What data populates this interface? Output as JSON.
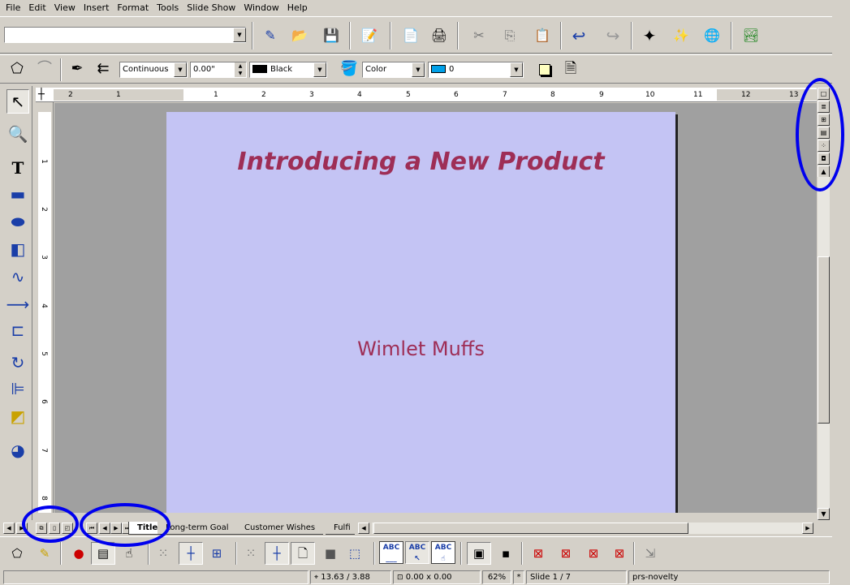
{
  "menu": [
    "File",
    "Edit",
    "View",
    "Insert",
    "Format",
    "Tools",
    "Slide Show",
    "Window",
    "Help"
  ],
  "function_bar": {
    "url_input_value": ""
  },
  "object_bar": {
    "line_style": "Continuous",
    "line_width": "0.00\"",
    "line_color": "Black",
    "line_color_hex": "#000000",
    "area_style": "Color",
    "area_color": "0",
    "area_color_hex": "#00a0e8"
  },
  "ruler": {
    "h_ticks": [
      "2",
      "1",
      "1",
      "2",
      "3",
      "4",
      "5",
      "6",
      "7",
      "8",
      "9",
      "10",
      "11",
      "12",
      "13"
    ],
    "v_ticks": [
      "1",
      "2",
      "3",
      "4",
      "5",
      "6",
      "7",
      "8"
    ]
  },
  "slide": {
    "title": "Introducing a New Product",
    "subtitle": "Wimlet Muffs",
    "background_hex": "#c4c4f4",
    "text_hex": "#9e2e56"
  },
  "tabs": [
    "Title",
    "Long-term Goal",
    "Customer Wishes",
    "Fulfi"
  ],
  "status": {
    "position": "13.63 / 3.88",
    "size": "0.00 x 0.00",
    "zoom": "62%",
    "modified": "*",
    "slide": "Slide 1 / 7",
    "layout": "prs-novelty"
  },
  "annotation_color": "#0000ee"
}
